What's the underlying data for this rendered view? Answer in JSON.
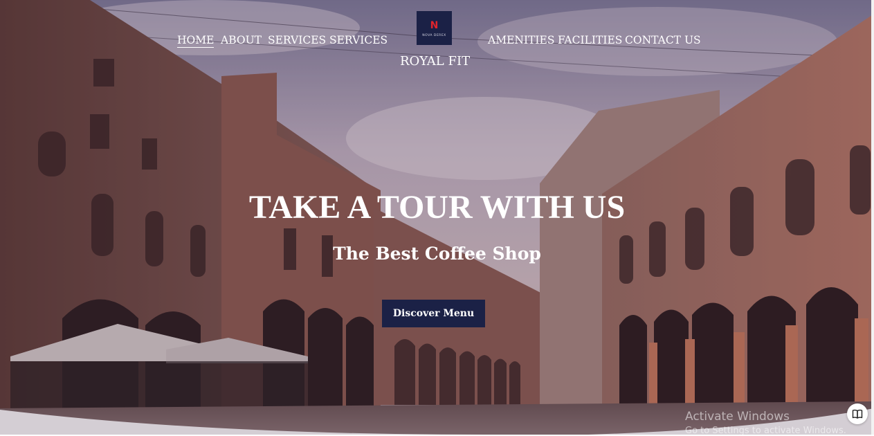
{
  "nav": {
    "items": [
      "HOME",
      "ABOUT",
      "SERVICES",
      "SERVICES",
      "AMENITIES",
      "FACILITIES",
      "CONTACT US"
    ],
    "active": "HOME"
  },
  "logo": {
    "mark": "N",
    "tagline": "NOVA DEREX",
    "brand": "ROYAL FIT"
  },
  "hero": {
    "headline": "TAKE A TOUR WITH US",
    "subhead": "The Best Coffee Shop",
    "cta_label": "Discover Menu"
  },
  "watermark": {
    "line1": "Activate Windows",
    "line2": "Go to Settings to activate Windows."
  },
  "colors": {
    "navy": "#1b2146",
    "logo_red": "#e0242c",
    "text": "#ffffff"
  },
  "icons": {
    "reader": "book-icon"
  }
}
